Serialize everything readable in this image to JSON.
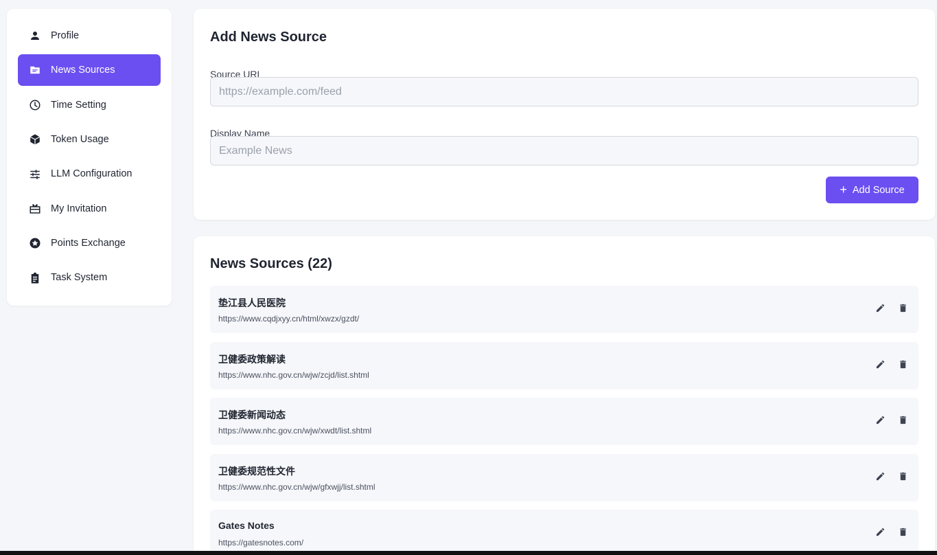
{
  "sidebar": {
    "items": [
      {
        "label": "Profile",
        "icon": "person-icon",
        "active": false
      },
      {
        "label": "News Sources",
        "icon": "folder-icon",
        "active": true
      },
      {
        "label": "Time Setting",
        "icon": "clock-icon",
        "active": false
      },
      {
        "label": "Token Usage",
        "icon": "cube-icon",
        "active": false
      },
      {
        "label": "LLM Configuration",
        "icon": "sliders-icon",
        "active": false
      },
      {
        "label": "My Invitation",
        "icon": "gift-card-icon",
        "active": false
      },
      {
        "label": "Points Exchange",
        "icon": "star-badge-icon",
        "active": false
      },
      {
        "label": "Task System",
        "icon": "clipboard-icon",
        "active": false
      }
    ]
  },
  "add_form": {
    "title": "Add News Source",
    "url_label": "Source URL",
    "url_value": "",
    "url_placeholder": "https://example.com/feed",
    "name_label": "Display Name",
    "name_value": "",
    "name_placeholder": "Example News",
    "submit_icon": "+",
    "submit_label": "Add Source"
  },
  "sources": {
    "title": "News Sources (22)",
    "items": [
      {
        "name": "垫江县人民医院",
        "url": "https://www.cqdjxyy.cn/html/xwzx/gzdt/"
      },
      {
        "name": "卫健委政策解读",
        "url": "https://www.nhc.gov.cn/wjw/zcjd/list.shtml"
      },
      {
        "name": "卫健委新闻动态",
        "url": "https://www.nhc.gov.cn/wjw/xwdt/list.shtml"
      },
      {
        "name": "卫健委规范性文件",
        "url": "https://www.nhc.gov.cn/wjw/gfxwjj/list.shtml"
      },
      {
        "name": "Gates Notes",
        "url": "https://gatesnotes.com/"
      }
    ]
  },
  "colors": {
    "accent": "#6b4ff0",
    "background": "#f5f6f9"
  }
}
